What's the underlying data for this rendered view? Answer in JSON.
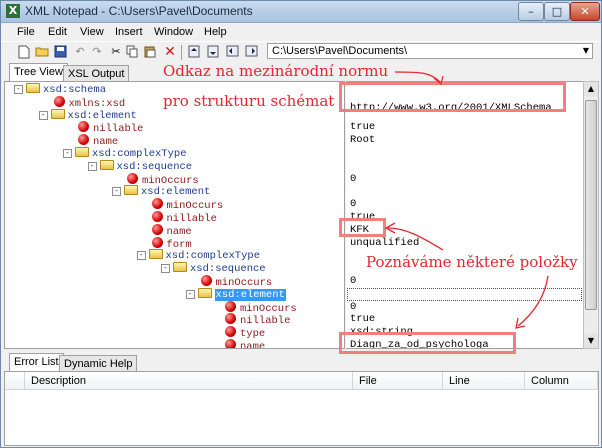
{
  "window": {
    "title": "XML Notepad - C:\\Users\\Pavel\\Documents",
    "app_icon": "X",
    "controls": {
      "minimize": "–",
      "maximize": "□",
      "close": "✕"
    }
  },
  "menu": [
    "File",
    "Edit",
    "View",
    "Insert",
    "Window",
    "Help"
  ],
  "toolbar": {
    "icons": [
      "new-file-icon",
      "open-folder-icon",
      "save-icon",
      "undo-icon",
      "redo-icon",
      "cut-icon",
      "copy-icon",
      "paste-icon",
      "delete-icon",
      "nudge-up-icon",
      "nudge-down-icon",
      "nudge-left-icon",
      "nudge-right-icon"
    ],
    "path_value": "C:\\Users\\Pavel\\Documents\\",
    "dropdown_arrow": "▼"
  },
  "tabs": {
    "tree_view": "Tree View",
    "xsl_output": "XSL Output"
  },
  "tree": [
    {
      "label": "xsd:schema",
      "kind": "el",
      "depth": 0,
      "toggle": "-"
    },
    {
      "label": "xmlns:xsd",
      "kind": "attr",
      "depth": 1,
      "toggle": ""
    },
    {
      "label": "xsd:element",
      "kind": "el",
      "depth": 1,
      "toggle": "-"
    },
    {
      "label": "nillable",
      "kind": "attr",
      "depth": 2,
      "toggle": ""
    },
    {
      "label": "name",
      "kind": "attr",
      "depth": 2,
      "toggle": ""
    },
    {
      "label": "xsd:complexType",
      "kind": "el",
      "depth": 2,
      "toggle": "-"
    },
    {
      "label": "xsd:sequence",
      "kind": "el",
      "depth": 3,
      "toggle": "-"
    },
    {
      "label": "minOccurs",
      "kind": "attr",
      "depth": 4,
      "toggle": ""
    },
    {
      "label": "xsd:element",
      "kind": "el",
      "depth": 4,
      "toggle": "-"
    },
    {
      "label": "minOccurs",
      "kind": "attr",
      "depth": 5,
      "toggle": ""
    },
    {
      "label": "nillable",
      "kind": "attr",
      "depth": 5,
      "toggle": ""
    },
    {
      "label": "name",
      "kind": "attr",
      "depth": 5,
      "toggle": ""
    },
    {
      "label": "form",
      "kind": "attr",
      "depth": 5,
      "toggle": ""
    },
    {
      "label": "xsd:complexType",
      "kind": "el",
      "depth": 5,
      "toggle": "-"
    },
    {
      "label": "xsd:sequence",
      "kind": "el",
      "depth": 6,
      "toggle": "-"
    },
    {
      "label": "minOccurs",
      "kind": "attr",
      "depth": 7,
      "toggle": ""
    },
    {
      "label": "xsd:element",
      "kind": "el",
      "depth": 7,
      "toggle": "-",
      "selected": true
    },
    {
      "label": "minOccurs",
      "kind": "attr",
      "depth": 8,
      "toggle": ""
    },
    {
      "label": "nillable",
      "kind": "attr",
      "depth": 8,
      "toggle": ""
    },
    {
      "label": "type",
      "kind": "attr",
      "depth": 8,
      "toggle": ""
    },
    {
      "label": "name",
      "kind": "attr",
      "depth": 8,
      "toggle": ""
    }
  ],
  "values": [
    "",
    "http://www.w3.org/2001/XMLSchema",
    "",
    "true",
    "Root",
    "",
    "",
    "0",
    "",
    "0",
    "true",
    "KFK",
    "unqualified",
    "",
    "",
    "0",
    "",
    "0",
    "true",
    "xsd:string",
    "Diagn_za_od_psychologa"
  ],
  "bottom_tabs": {
    "error_list": "Error List",
    "dynamic_help": "Dynamic Help"
  },
  "error_columns": [
    "Description",
    "File",
    "Line",
    "Column"
  ],
  "annotations": {
    "top_line1": "Odkaz na mezinárodní normu",
    "top_line2": "pro strukturu schémat",
    "middle": "Poznáváme některé položky",
    "color": "#e8252f",
    "box_color": "#f08080"
  }
}
